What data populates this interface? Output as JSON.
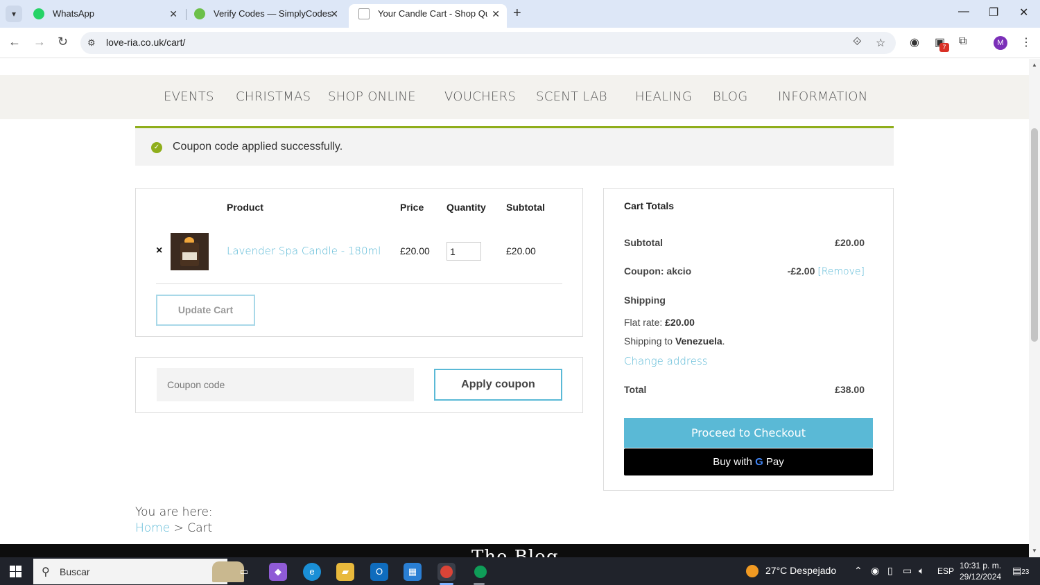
{
  "browser": {
    "tabs": [
      {
        "title": "WhatsApp"
      },
      {
        "title": "Verify Codes — SimplyCodes"
      },
      {
        "title": "Your Candle Cart - Shop Quality"
      }
    ],
    "url": "love-ria.co.uk/cart/",
    "extension_badge": "7",
    "profile_initial": "M"
  },
  "nav": {
    "items": [
      "EVENTS",
      "CHRISTMAS",
      "SHOP ONLINE",
      "VOUCHERS",
      "SCENT LAB",
      "HEALING",
      "BLOG",
      "INFORMATION"
    ]
  },
  "notice": {
    "message": "Coupon code applied successfully."
  },
  "cart": {
    "headers": {
      "product": "Product",
      "price": "Price",
      "quantity": "Quantity",
      "subtotal": "Subtotal"
    },
    "items": [
      {
        "name": "Lavender Spa Candle - 180ml",
        "price": "£20.00",
        "quantity": "1",
        "subtotal": "£20.00"
      }
    ],
    "update_label": "Update Cart"
  },
  "coupon": {
    "placeholder": "Coupon code",
    "apply_label": "Apply coupon"
  },
  "totals": {
    "title": "Cart Totals",
    "subtotal_label": "Subtotal",
    "subtotal_value": "£20.00",
    "coupon_label": "Coupon: akcio",
    "coupon_value": "-£2.00",
    "coupon_remove": "[Remove]",
    "shipping_label": "Shipping",
    "flat_rate_prefix": "Flat rate: ",
    "flat_rate_value": "£20.00",
    "shipping_to_prefix": "Shipping to ",
    "shipping_country": "Venezuela",
    "shipping_to_suffix": ".",
    "change_address": "Change address",
    "total_label": "Total",
    "total_value": "£38.00",
    "checkout_label": "Proceed to Checkout",
    "gpay_prefix": "Buy with",
    "gpay_g": "G",
    "gpay_pay": "Pay"
  },
  "breadcrumb": {
    "label": "You are here:",
    "home": "Home",
    "current": "> Cart"
  },
  "footer": {
    "heading": "The Blog"
  },
  "taskbar": {
    "search_text": "Buscar",
    "weather": "27°C  Despejado",
    "language": "ESP",
    "time": "10:31 p. m.",
    "date": "29/12/2024",
    "notifications": "23"
  }
}
